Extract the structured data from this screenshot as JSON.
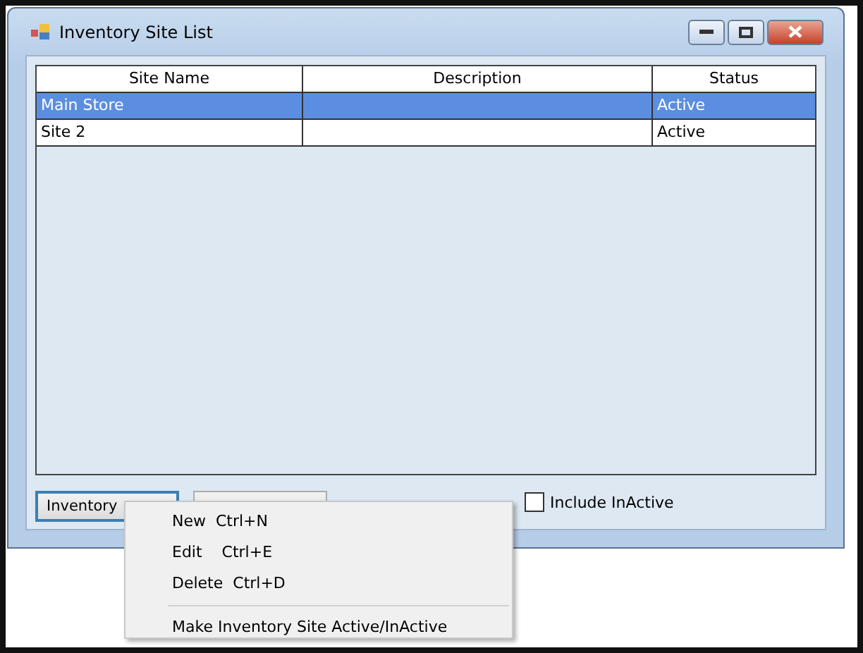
{
  "window": {
    "title": "Inventory Site List"
  },
  "table": {
    "columns": [
      "Site Name",
      "Description",
      "Status"
    ],
    "rows": [
      {
        "cells": [
          "Main Store",
          "",
          "Active"
        ],
        "selected": true
      },
      {
        "cells": [
          "Site 2",
          "",
          "Active"
        ],
        "selected": false
      }
    ]
  },
  "buttons": [
    {
      "label": "Inventory",
      "focused": true
    },
    {
      "focused": false
    }
  ],
  "include_inactive": {
    "label": "Include InActive",
    "checked": false
  },
  "context_menu": {
    "items": [
      {
        "kind": "item",
        "label": "New  Ctrl+N"
      },
      {
        "kind": "item",
        "label": "Edit    Ctrl+E"
      },
      {
        "kind": "item",
        "label": "Delete  Ctrl+D"
      },
      {
        "kind": "separator"
      },
      {
        "kind": "item",
        "label": "Make Inventory Site Active/InActive"
      }
    ]
  }
}
